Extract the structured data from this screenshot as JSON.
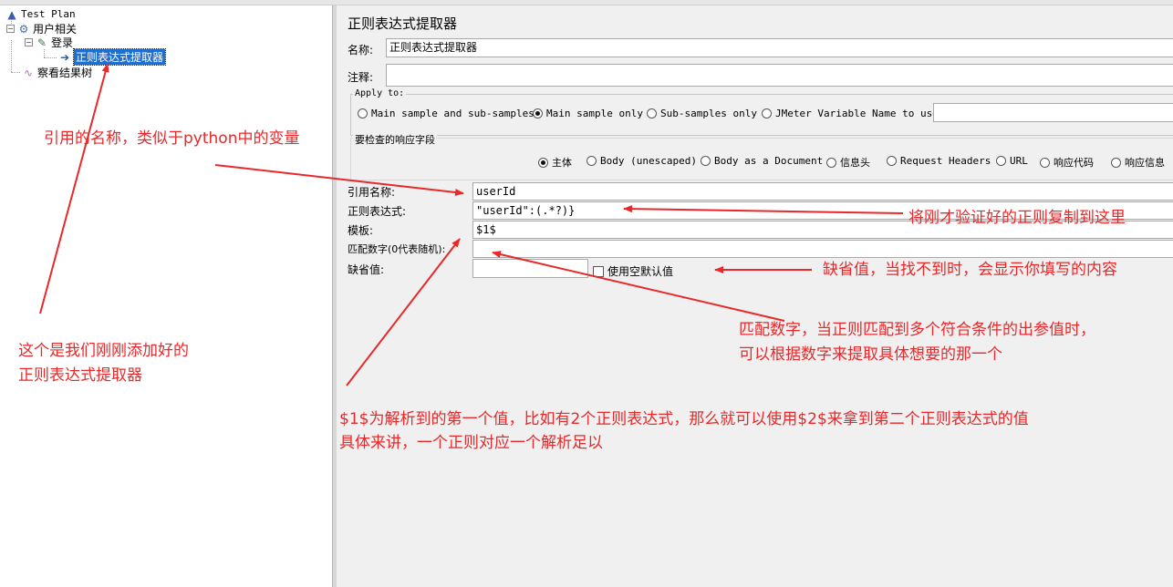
{
  "tree": {
    "items": [
      {
        "label": "Test Plan"
      },
      {
        "label": "用户相关"
      },
      {
        "label": "登录"
      },
      {
        "label": "正则表达式提取器"
      },
      {
        "label": "察看结果树"
      }
    ]
  },
  "panel": {
    "title": "正则表达式提取器",
    "name_label": "名称:",
    "name_value": "正则表达式提取器",
    "comment_label": "注释:",
    "comment_value": "",
    "apply_to": {
      "legend": "Apply to:",
      "options": [
        "Main sample and sub-samples",
        "Main sample only",
        "Sub-samples only",
        "JMeter Variable Name to use"
      ],
      "selected": "Main sample only",
      "variable_value": ""
    },
    "field_to_check": {
      "legend": "要检查的响应字段",
      "options": [
        "主体",
        "Body (unescaped)",
        "Body as a Document",
        "信息头",
        "Request Headers",
        "URL",
        "响应代码",
        "响应信息"
      ],
      "selected": "主体"
    },
    "ref_name_label": "引用名称:",
    "ref_name_value": "userId",
    "regex_label": "正则表达式:",
    "regex_value": "\"userId\":(.*?)}",
    "template_label": "模板:",
    "template_value": "$1$",
    "match_no_label": "匹配数字(0代表随机):",
    "match_no_value": "",
    "default_label": "缺省值:",
    "default_value": "",
    "empty_default_label": "使用空默认值",
    "empty_default_checked": false
  },
  "annotations": {
    "ref_name_note": "引用的名称，类似于python中的变量",
    "regex_note": "将刚才验证好的正则复制到这里",
    "default_note": "缺省值，当找不到时，会显示你填写的内容",
    "match_note_line1": "匹配数字，当正则匹配到多个符合条件的出参值时，",
    "match_note_line2": "可以根据数字来提取具体想要的那一个",
    "tree_note_line1": "这个是我们刚刚添加好的",
    "tree_note_line2": "正则表达式提取器",
    "template_note_line1": "$1$为解析到的第一个值，比如有2个正则表达式，那么就可以使用$2$来拿到第二个正则表达式的值",
    "template_note_line2": "具体来讲，一个正则对应一个解析足以"
  },
  "colors": {
    "annotation": "#e8282a",
    "selection": "#1f6fd1"
  }
}
